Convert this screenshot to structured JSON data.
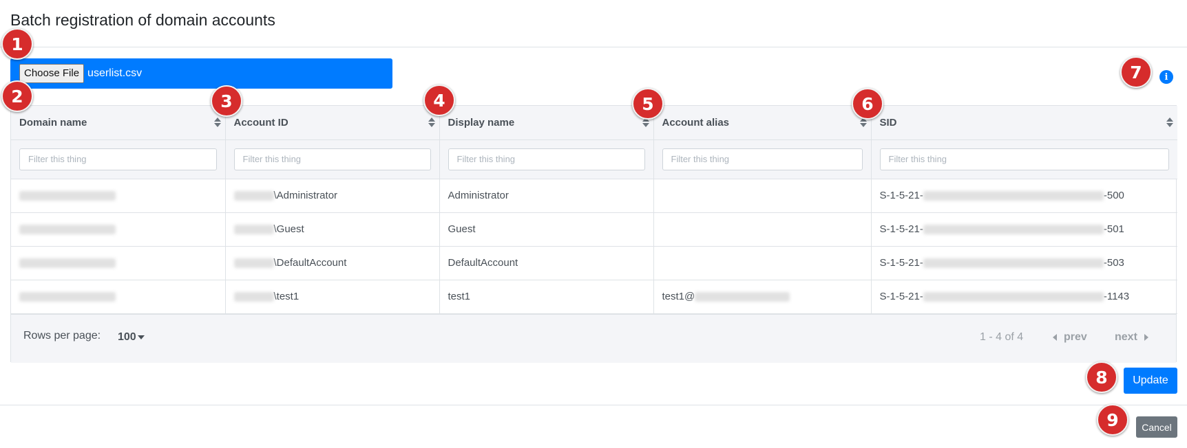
{
  "page": {
    "title": "Batch registration of domain accounts"
  },
  "file": {
    "button_label": "Choose File",
    "file_name": "userlist.csv"
  },
  "info_icon": {
    "glyph": "i",
    "icon": "info-circle-icon"
  },
  "table": {
    "columns": [
      {
        "label": "Domain name",
        "filter_placeholder": "Filter this thing"
      },
      {
        "label": "Account ID",
        "filter_placeholder": "Filter this thing"
      },
      {
        "label": "Display name",
        "filter_placeholder": "Filter this thing"
      },
      {
        "label": "Account alias",
        "filter_placeholder": "Filter this thing"
      },
      {
        "label": "SID",
        "filter_placeholder": "Filter this thing"
      }
    ],
    "rows": [
      {
        "account_suffix": "\\Administrator",
        "display_name": "Administrator",
        "alias_prefix": "",
        "sid_prefix": "S-1-5-21-",
        "sid_suffix": "-500"
      },
      {
        "account_suffix": "\\Guest",
        "display_name": "Guest",
        "alias_prefix": "",
        "sid_prefix": "S-1-5-21-",
        "sid_suffix": "-501"
      },
      {
        "account_suffix": "\\DefaultAccount",
        "display_name": "DefaultAccount",
        "alias_prefix": "",
        "sid_prefix": "S-1-5-21-",
        "sid_suffix": "-503"
      },
      {
        "account_suffix": "\\test1",
        "display_name": "test1",
        "alias_prefix": "test1@",
        "sid_prefix": "S-1-5-21-",
        "sid_suffix": "-1143"
      }
    ]
  },
  "pagination": {
    "rows_per_page_label": "Rows per page:",
    "rows_per_page_value": "100",
    "range_text": "1 - 4 of 4",
    "prev_label": "prev",
    "next_label": "next"
  },
  "actions": {
    "update_label": "Update",
    "cancel_label": "Cancel"
  },
  "annotations": [
    "1",
    "2",
    "3",
    "4",
    "5",
    "6",
    "7",
    "8",
    "9"
  ],
  "colors": {
    "primary": "#007bff",
    "secondary": "#6c757d",
    "marker": "#d62c2c"
  }
}
